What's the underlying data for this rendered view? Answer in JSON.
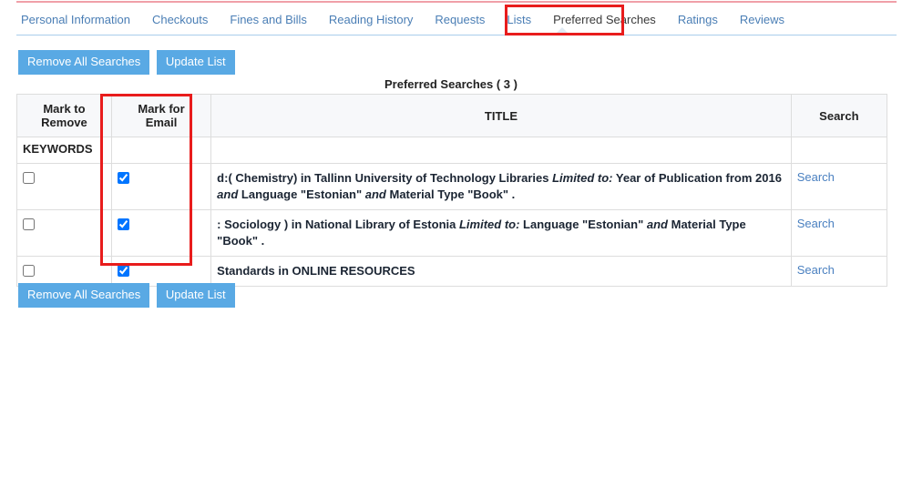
{
  "theme": {
    "accent_blue": "#59a9e4",
    "link_blue": "#4a80c0",
    "tab_blue": "#4a7eb5",
    "annotation_red": "#e81c1c",
    "top_rule_pink": "#f0a0a8",
    "header_bg": "#f7f8fa"
  },
  "tabs": [
    {
      "label": "Personal Information",
      "active": false
    },
    {
      "label": "Checkouts",
      "active": false
    },
    {
      "label": "Fines and Bills",
      "active": false
    },
    {
      "label": "Reading History",
      "active": false
    },
    {
      "label": "Requests",
      "active": false
    },
    {
      "label": "Lists",
      "active": false
    },
    {
      "label": "Preferred Searches",
      "active": true
    },
    {
      "label": "Ratings",
      "active": false
    },
    {
      "label": "Reviews",
      "active": false
    }
  ],
  "toolbar": {
    "remove_all_label": "Remove All Searches",
    "update_list_label": "Update List"
  },
  "caption": "Preferred Searches ( 3 )",
  "table": {
    "headers": {
      "mark_to_remove": "Mark to Remove",
      "mark_to_remove_line1": "Mark to",
      "mark_to_remove_line2": "Remove",
      "mark_for_email": "Mark for Email",
      "mark_for_email_line1": "Mark for",
      "mark_for_email_line2": "Email",
      "title": "TITLE",
      "search": "Search"
    },
    "group_label": "KEYWORDS",
    "rows": [
      {
        "remove_checked": false,
        "email_checked": true,
        "title_parts": [
          {
            "text": "d:( Chemistry) in Tallinn University of Technology Libraries ",
            "italic": false
          },
          {
            "text": "Limited to:",
            "italic": true
          },
          {
            "text": " Year of Publication from 2016 ",
            "italic": false
          },
          {
            "text": "and",
            "italic": true
          },
          {
            "text": " Language \"Estonian\" ",
            "italic": false
          },
          {
            "text": "and",
            "italic": true
          },
          {
            "text": " Material Type \"Book\" .",
            "italic": false
          }
        ],
        "search_label": "Search"
      },
      {
        "remove_checked": false,
        "email_checked": true,
        "title_parts": [
          {
            "text": ": Sociology ) in National Library of Estonia ",
            "italic": false
          },
          {
            "text": "Limited to:",
            "italic": true
          },
          {
            "text": " Language \"Estonian\" ",
            "italic": false
          },
          {
            "text": "and",
            "italic": true
          },
          {
            "text": " Material Type \"Book\" .",
            "italic": false
          }
        ],
        "search_label": "Search"
      },
      {
        "remove_checked": false,
        "email_checked": true,
        "title_parts": [
          {
            "text": "Standards in ONLINE RESOURCES",
            "italic": false
          }
        ],
        "search_label": "Search"
      }
    ]
  }
}
